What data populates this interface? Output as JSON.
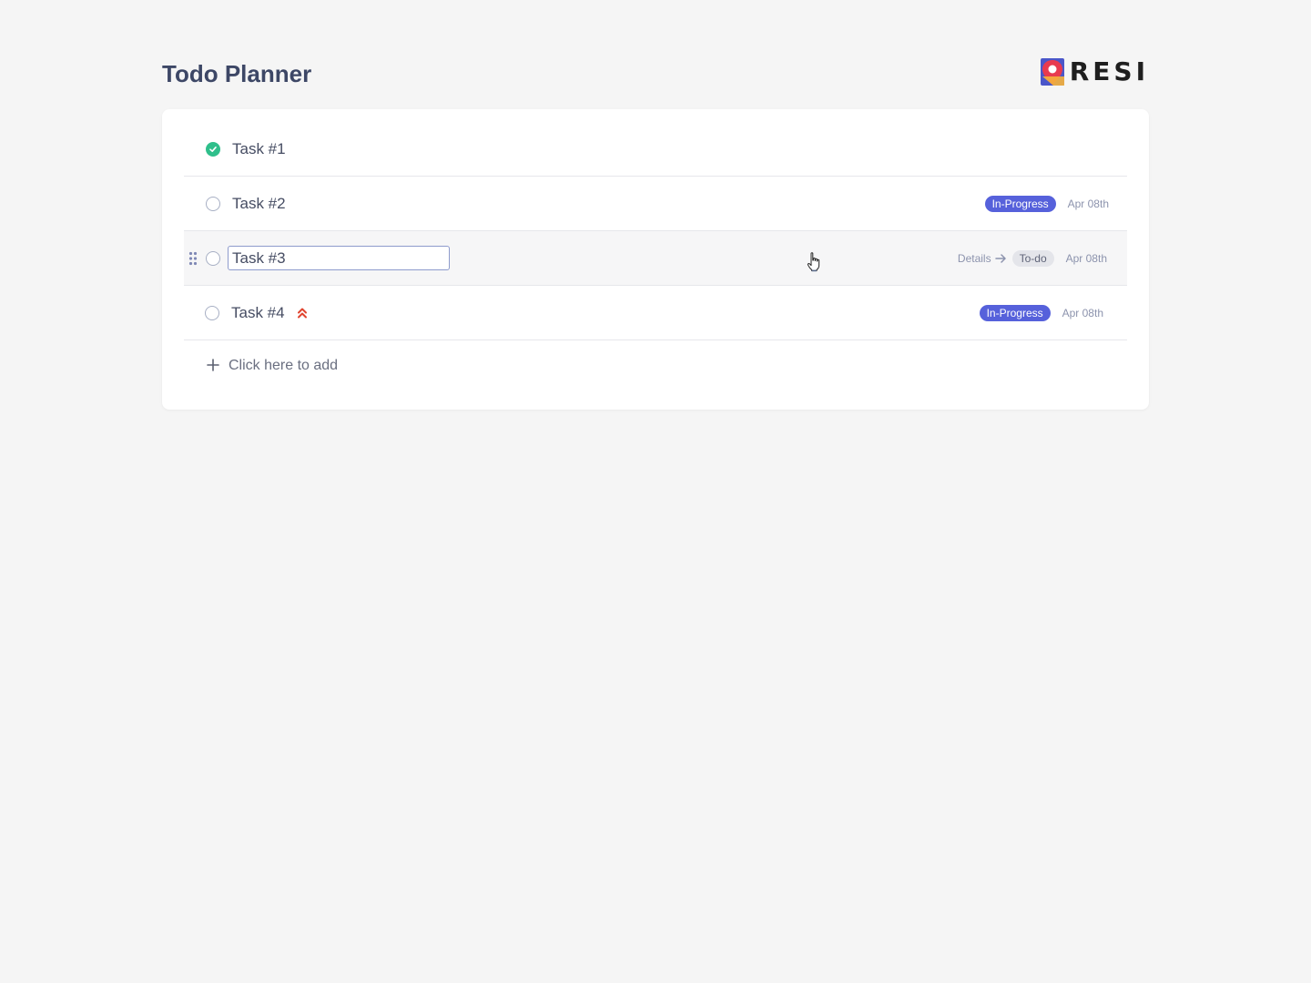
{
  "header": {
    "title": "Todo Planner",
    "logo_text": "RESI"
  },
  "tasks": [
    {
      "label": "Task #1",
      "done": true,
      "status": "",
      "date": ""
    },
    {
      "label": "Task #2",
      "done": false,
      "status": "In-Progress",
      "date": "Apr 08th"
    },
    {
      "label": "Task #3",
      "done": false,
      "status": "To-do",
      "date": "Apr 08th",
      "details_label": "Details",
      "editing": true
    },
    {
      "label": "Task #4",
      "done": false,
      "status": "In-Progress",
      "date": "Apr 08th",
      "priority": "high"
    }
  ],
  "add": {
    "label": "Click here to add"
  },
  "colors": {
    "accent": "#5661db",
    "done": "#2fbf8b",
    "priority_high": "#e0442f",
    "title": "#3d4766"
  },
  "icons": {
    "done": "check-circle-icon",
    "drag": "drag-handle-icon",
    "priority": "double-chevron-up-icon",
    "add": "plus-icon",
    "details": "arrow-right-icon",
    "cursor": "hand-pointer-icon"
  }
}
